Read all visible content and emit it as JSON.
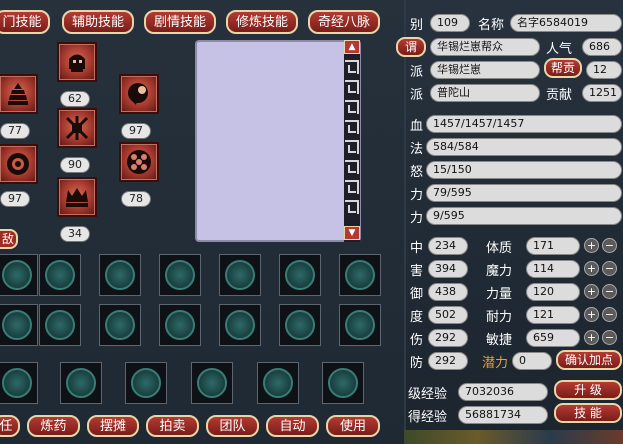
{
  "tabs": [
    "门技能",
    "辅助技能",
    "剧情技能",
    "修炼技能",
    "奇经八脉"
  ],
  "skills": {
    "levels": [
      "62",
      "77",
      "97",
      "90",
      "97",
      "78",
      "34"
    ],
    "icons": [
      "helmet-icon",
      "pagoda-icon",
      "spirit-head-icon",
      "crossed-blades-icon",
      "seal-disc-icon",
      "dots-grid-icon",
      "crown-icon"
    ]
  },
  "left_small_button": "敌",
  "bottom_buttons": [
    "任",
    "炼药",
    "摆摊",
    "拍卖",
    "团队",
    "自动",
    "使用"
  ],
  "stats": {
    "rank_label": "别",
    "rank_value": "109",
    "name_label": "名称",
    "name_value": "名字6584019",
    "title_label": "谓",
    "title_value": "华锡烂崽帮众",
    "popularity_label": "人气",
    "popularity_value": "686",
    "gang_label": "派",
    "gang_value": "华锡烂崽",
    "contribution_btn": "帮贡",
    "contribution_value": "12",
    "sect_label": "派",
    "sect_value": "普陀山",
    "devotion_label": "贡献",
    "devotion_value": "1251",
    "hp_label": "血",
    "hp_value": "1457/1457/1457",
    "mp_label": "法",
    "mp_value": "584/584",
    "anger_label": "怒",
    "anger_value": "15/150",
    "vitality_label": "力",
    "vitality_value": "79/595",
    "energy_label": "力",
    "energy_value": "9/595"
  },
  "attributes": {
    "left": [
      {
        "label": "中",
        "value": "234"
      },
      {
        "label": "害",
        "value": "394"
      },
      {
        "label": "御",
        "value": "438"
      },
      {
        "label": "度",
        "value": "502"
      },
      {
        "label": "伤",
        "value": "292"
      },
      {
        "label": "防",
        "value": "292"
      }
    ],
    "right": [
      {
        "label": "体质",
        "value": "171"
      },
      {
        "label": "魔力",
        "value": "114"
      },
      {
        "label": "力量",
        "value": "120"
      },
      {
        "label": "耐力",
        "value": "121"
      },
      {
        "label": "敏捷",
        "value": "659"
      }
    ],
    "potential_label": "潜力",
    "potential_value": "0",
    "confirm_btn": "确认加点"
  },
  "experience": {
    "level_exp_label": "级经验",
    "level_exp_value": "7032036",
    "gain_exp_label": "得经验",
    "gain_exp_value": "56881734",
    "upgrade_btn": "升 级",
    "skill_btn": "技 能"
  }
}
